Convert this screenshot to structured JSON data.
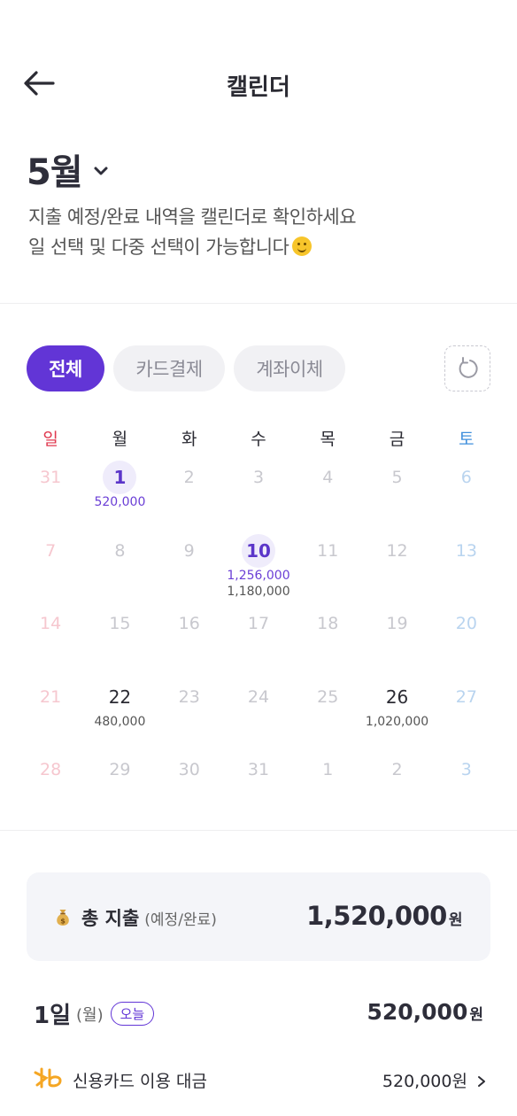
{
  "header": {
    "title": "캘린더"
  },
  "month": {
    "label": "5월"
  },
  "description": {
    "line1": "지출 예정/완료 내역을 캘린더로 확인하세요",
    "line2": "일 선택 및 다중 선택이 가능합니다"
  },
  "filters": [
    {
      "label": "전체",
      "active": true
    },
    {
      "label": "카드결제",
      "active": false
    },
    {
      "label": "계좌이체",
      "active": false
    }
  ],
  "calendar": {
    "weekdays": [
      "일",
      "월",
      "화",
      "수",
      "목",
      "금",
      "토"
    ],
    "weekday_colors": {
      "sun": "#e0394f",
      "sat": "#3f8fdc"
    },
    "weeks": [
      [
        {
          "d": "31"
        },
        {
          "d": "1",
          "state": "selected",
          "amounts": [
            "520,000"
          ],
          "amount_color": "purple"
        },
        {
          "d": "2"
        },
        {
          "d": "3"
        },
        {
          "d": "4"
        },
        {
          "d": "5"
        },
        {
          "d": "6"
        }
      ],
      [
        {
          "d": "7"
        },
        {
          "d": "8"
        },
        {
          "d": "9"
        },
        {
          "d": "10",
          "state": "selected",
          "amounts": [
            "1,256,000",
            "1,180,000"
          ]
        },
        {
          "d": "11"
        },
        {
          "d": "12"
        },
        {
          "d": "13"
        }
      ],
      [
        {
          "d": "14"
        },
        {
          "d": "15"
        },
        {
          "d": "16"
        },
        {
          "d": "17"
        },
        {
          "d": "18"
        },
        {
          "d": "19"
        },
        {
          "d": "20"
        }
      ],
      [
        {
          "d": "21"
        },
        {
          "d": "22",
          "state": "active",
          "amounts": [
            "480,000"
          ]
        },
        {
          "d": "23"
        },
        {
          "d": "24"
        },
        {
          "d": "25"
        },
        {
          "d": "26",
          "state": "active",
          "amounts": [
            "1,020,000"
          ]
        },
        {
          "d": "27"
        }
      ],
      [
        {
          "d": "28"
        },
        {
          "d": "29"
        },
        {
          "d": "30"
        },
        {
          "d": "31"
        },
        {
          "d": "1"
        },
        {
          "d": "2"
        },
        {
          "d": "3"
        }
      ]
    ]
  },
  "total": {
    "label": "총 지출",
    "sub_label": "(예정/완료)",
    "amount": "1,520,000",
    "unit": "원"
  },
  "day_summary": {
    "date": "1일",
    "weekday": "(월)",
    "badge": "오늘",
    "amount": "520,000",
    "unit": "원"
  },
  "items": [
    {
      "label": "신용카드 이용 대금",
      "amount": "520,000",
      "unit": "원"
    }
  ],
  "colors": {
    "accent": "#6235d6",
    "logo_orange": "#f5a623"
  }
}
